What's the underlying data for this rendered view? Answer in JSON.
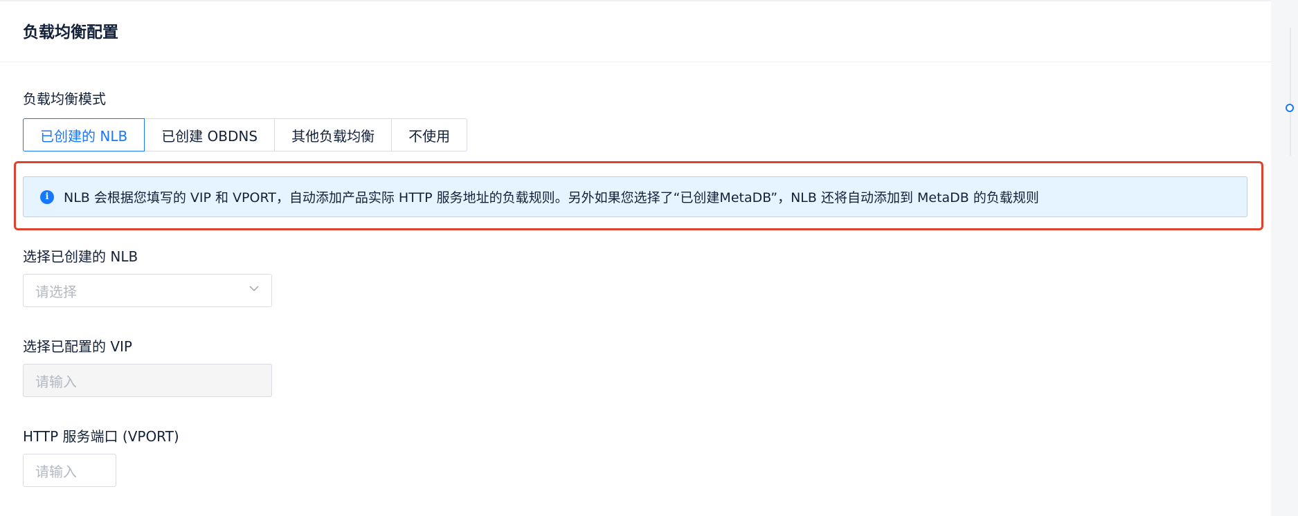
{
  "card": {
    "title": "负载均衡配置"
  },
  "lb_mode": {
    "label": "负载均衡模式",
    "options": [
      "已创建的 NLB",
      "已创建 OBDNS",
      "其他负载均衡",
      "不使用"
    ],
    "selected": "已创建的 NLB"
  },
  "alert": {
    "icon": "info-icon",
    "text": "NLB 会根据您填写的 VIP 和 VPORT，自动添加产品实际 HTTP 服务地址的负载规则。另外如果您选择了“已创建MetaDB”，NLB 还将自动添加到 MetaDB 的负载规则"
  },
  "nlb_select": {
    "label": "选择已创建的 NLB",
    "placeholder": "请选择"
  },
  "vip_input": {
    "label": "选择已配置的 VIP",
    "placeholder": "请输入"
  },
  "vport_input": {
    "label": "HTTP 服务端口 (VPORT)",
    "placeholder": "请输入"
  },
  "colors": {
    "accent": "#1677ff",
    "highlight_border": "#e0412f",
    "alert_bg": "#e6f4ff"
  }
}
